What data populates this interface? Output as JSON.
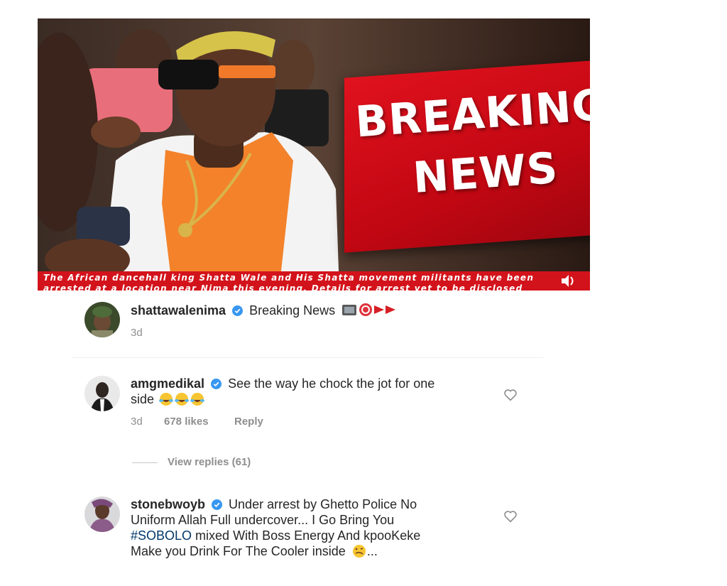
{
  "hero": {
    "banner_line1": "BREAKING",
    "banner_line2": "NEWS",
    "ticker_line1": "The African dancehall king Shatta Wale and His Shatta movement militants have been",
    "ticker_line2": "arrested at a location near Nima this evening. Details for arrest yet to be disclosed"
  },
  "post": {
    "username": "shattawalenima",
    "caption": "Breaking News",
    "caption_emojis": [
      "television-emoji",
      "sticker-13-emoji",
      "red-triangle-emoji",
      "red-triangle-emoji"
    ],
    "time": "3d"
  },
  "comments": [
    {
      "username": "amgmedikal",
      "text_line1": "See the way he chock the jot for one",
      "text_line2": "side",
      "emojis": [
        "laughing-tears-emoji",
        "laughing-tears-emoji",
        "laughing-tears-emoji"
      ],
      "time": "3d",
      "likes": "678 likes",
      "reply": "Reply",
      "view_replies": "View replies (61)"
    },
    {
      "username": "stonebwoyb",
      "text_line1": "Under arrest by Ghetto Police No",
      "text_line2": "Uniform Allah Full undercover... I Go Bring You",
      "hashtag": "#SOBOLO",
      "text_line3_rest": " mixed With Boss Energy And kpooKeke",
      "text_line4": "Make you Drink For The Cooler inside",
      "text_line4_suffix": "...",
      "emojis": [
        "woozy-face-emoji"
      ]
    }
  ],
  "colors": {
    "verified": "#3897f0",
    "banner_red": "#d3131b",
    "muted": "#8e8e8e",
    "hashtag": "#00376b"
  }
}
